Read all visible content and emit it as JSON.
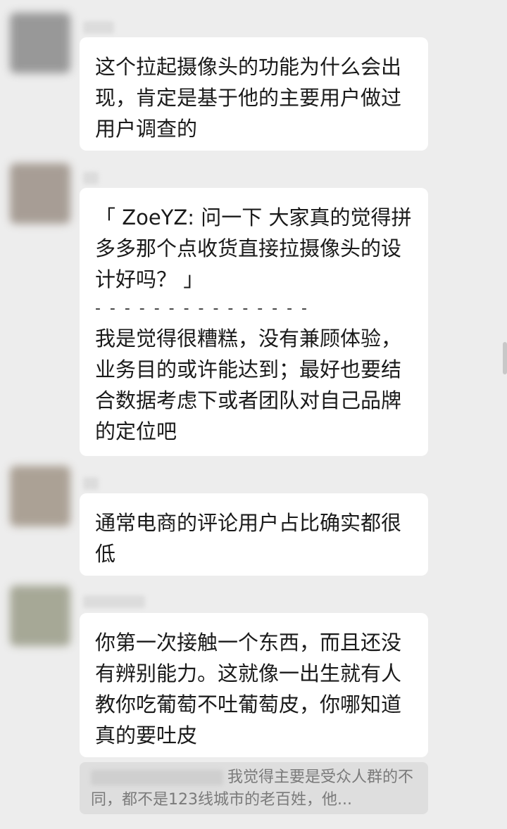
{
  "messages": [
    {
      "avatar_color": "#8a8a8a",
      "text": "这个拉起摄像头的功能为什么会出现，肯定是基于他的主要用户做过用户调查的"
    },
    {
      "avatar_color": "#9b9086",
      "quote": "「 ZoeYZ: 问一下 大家真的觉得拼多多那个点收货直接拉摄像头的设计好吗？ 」",
      "separator": "- - - - - - - - - - - - - - -",
      "text": "我是觉得很糟糕，没有兼顾体验，业务目的或许能达到；最好也要结合数据考虑下或者团队对自己品牌的定位吧"
    },
    {
      "avatar_color": "#a09486",
      "text": "通常电商的评论用户占比确实都很低"
    },
    {
      "avatar_color": "#9a9c88",
      "text": "你第一次接触一个东西，而且还没有辨别能力。这就像一出生就有人教你吃葡萄不吐葡萄皮，你哪知道真的要吐皮"
    }
  ],
  "quoted_reply": {
    "text": "我觉得主要是受众人群的不同，都不是123线城市的老百姓，他..."
  }
}
